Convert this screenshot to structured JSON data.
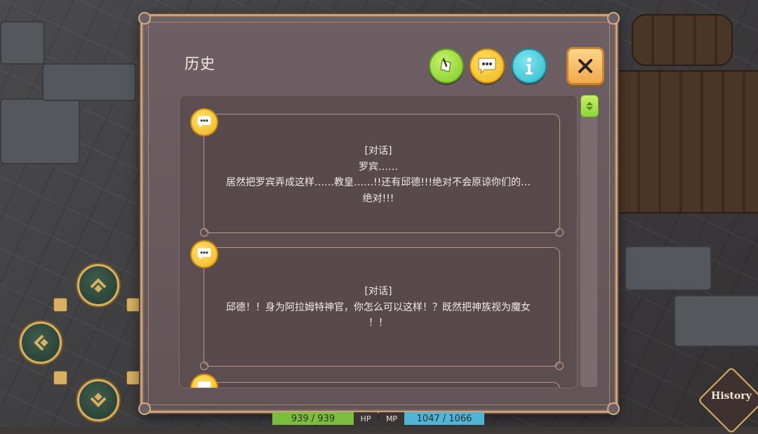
{
  "panel": {
    "title": "历史",
    "buttons": {
      "note_icon": "note-paper-icon",
      "chat_icon": "speech-bubble-icon",
      "info_icon": "info-icon",
      "close_icon": "close-x-icon"
    }
  },
  "history_entries": [
    {
      "type_icon": "speech-bubble-icon",
      "text": "[对话]\n罗宾……\n居然把罗宾弄成这样……教皇……!!还有邱德!!!绝对不会原谅你们的…\n绝对!!!"
    },
    {
      "type_icon": "speech-bubble-icon",
      "text": "[对话]\n邱德！！身为阿拉姆特神官，你怎么可以这样！？既然把神族视为魔女\n！！"
    },
    {
      "type_icon": "speech-bubble-icon",
      "text": ""
    }
  ],
  "hud": {
    "hp_value": "939 / 939",
    "hp_label": "HP",
    "mp_label": "MP",
    "mp_value": "1047 / 1066",
    "history_button": "History"
  },
  "colors": {
    "panel_bg": "#6d5f63",
    "panel_border": "#caa27c",
    "note_button": "#8fd43a",
    "chat_button": "#f0b51c",
    "info_button": "#2fb9cc",
    "close_button": "#f2a94d",
    "hp_bar": "#7bbd3c",
    "mp_bar": "#4fb4d6"
  }
}
